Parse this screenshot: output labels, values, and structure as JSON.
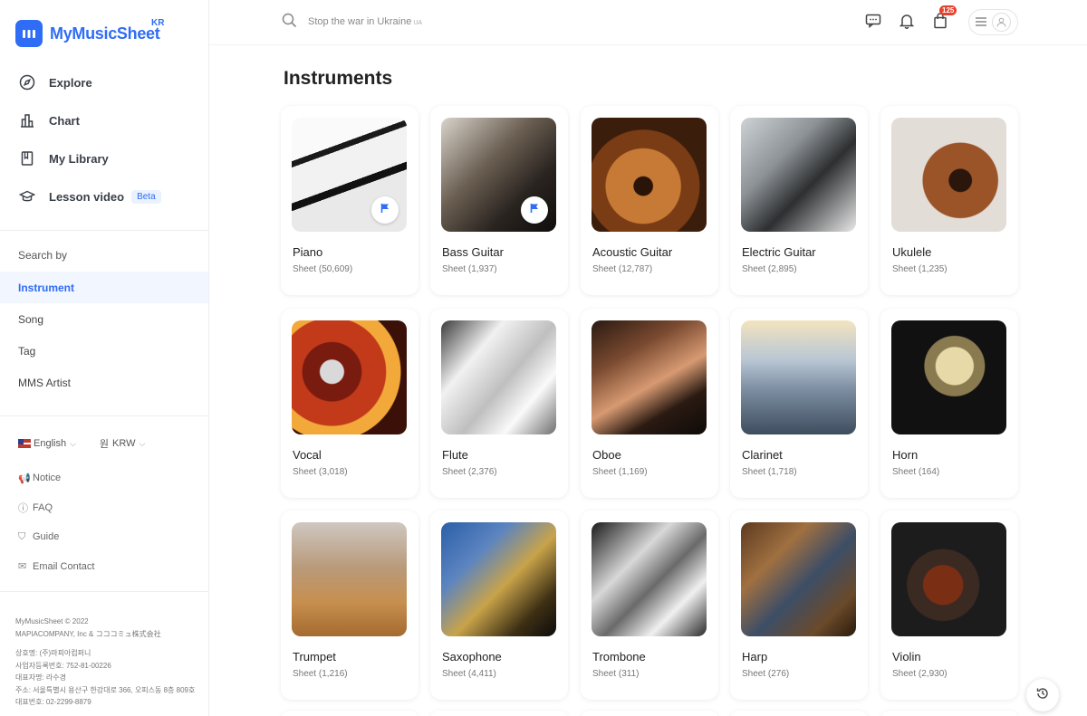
{
  "brand": {
    "name": "MyMusicSheet",
    "region": "KR",
    "color": "#2f6df6"
  },
  "nav": [
    {
      "label": "Explore",
      "icon": "compass-icon"
    },
    {
      "label": "Chart",
      "icon": "bar-chart-icon"
    },
    {
      "label": "My Library",
      "icon": "bookmark-book-icon"
    },
    {
      "label": "Lesson video",
      "icon": "graduation-cap-icon",
      "badge": "Beta"
    }
  ],
  "search_by": {
    "heading": "Search by",
    "items": [
      "Instrument",
      "Song",
      "Tag",
      "MMS Artist"
    ],
    "active": "Instrument"
  },
  "prefs": {
    "language": "English",
    "currency_symbol": "원",
    "currency": "KRW"
  },
  "links": [
    {
      "label": "Notice",
      "icon": "megaphone-icon"
    },
    {
      "label": "FAQ",
      "icon": "question-circle-icon"
    },
    {
      "label": "Guide",
      "icon": "guide-shield-icon"
    },
    {
      "label": "Email Contact",
      "icon": "mail-chat-icon"
    }
  ],
  "footer": {
    "copyright": "MyMusicSheet © 2022",
    "company": "MAPIACOMPANY, Inc & コココミュ株式会社",
    "line1": "상호명: (주)마피아컴퍼니",
    "line2": "사업자등록번호: 752-81-00226",
    "line3": "대표자명: 라수경",
    "line4": "주소: 서울특별시 용산구 한강대로 366, 오피스동 8층 809호",
    "line5": "대표번호: 02-2299-8879"
  },
  "topbar": {
    "search_placeholder": "Stop the war in Ukraine",
    "search_suffix": "UA",
    "cart_count": "125"
  },
  "page": {
    "title": "Instruments",
    "instruments": [
      {
        "name": "Piano",
        "count": "Sheet (50,609)",
        "bookmarked": true
      },
      {
        "name": "Bass Guitar",
        "count": "Sheet (1,937)",
        "bookmarked": true
      },
      {
        "name": "Acoustic Guitar",
        "count": "Sheet (12,787)",
        "bookmarked": false
      },
      {
        "name": "Electric Guitar",
        "count": "Sheet (2,895)",
        "bookmarked": false
      },
      {
        "name": "Ukulele",
        "count": "Sheet (1,235)",
        "bookmarked": false
      },
      {
        "name": "Vocal",
        "count": "Sheet (3,018)",
        "bookmarked": false
      },
      {
        "name": "Flute",
        "count": "Sheet (2,376)",
        "bookmarked": false
      },
      {
        "name": "Oboe",
        "count": "Sheet (1,169)",
        "bookmarked": false
      },
      {
        "name": "Clarinet",
        "count": "Sheet (1,718)",
        "bookmarked": false
      },
      {
        "name": "Horn",
        "count": "Sheet (164)",
        "bookmarked": false
      },
      {
        "name": "Trumpet",
        "count": "Sheet (1,216)",
        "bookmarked": false
      },
      {
        "name": "Saxophone",
        "count": "Sheet (4,411)",
        "bookmarked": false
      },
      {
        "name": "Trombone",
        "count": "Sheet (311)",
        "bookmarked": false
      },
      {
        "name": "Harp",
        "count": "Sheet (276)",
        "bookmarked": false
      },
      {
        "name": "Violin",
        "count": "Sheet (2,930)",
        "bookmarked": false
      }
    ]
  }
}
